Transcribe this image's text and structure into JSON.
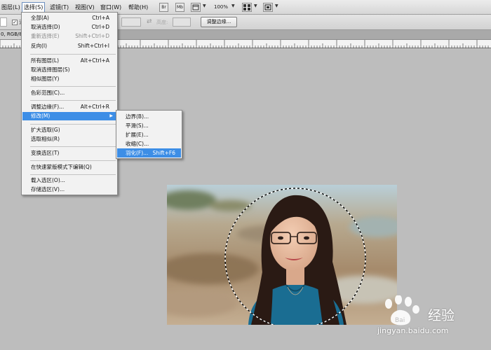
{
  "menubar": {
    "items": [
      "图层(L)",
      "选择(S)",
      "滤镜(T)",
      "视图(V)",
      "窗口(W)",
      "帮助(H)"
    ],
    "toolbar_buttons": [
      "Br",
      "Mb"
    ],
    "zoom": "100%"
  },
  "options": {
    "anti_alias": "消",
    "height_label": "高度:",
    "refine_edge_button": "调整边缘..."
  },
  "document": {
    "tab_label": "0, RGB/8"
  },
  "select_menu": {
    "items": [
      {
        "label": "全部(A)",
        "shortcut": "Ctrl+A"
      },
      {
        "label": "取消选择(D)",
        "shortcut": "Ctrl+D"
      },
      {
        "label": "重新选择(E)",
        "shortcut": "Shift+Ctrl+D"
      },
      {
        "label": "反向(I)",
        "shortcut": "Shift+Ctrl+I"
      },
      {
        "label": "所有图层(L)",
        "shortcut": "Alt+Ctrl+A"
      },
      {
        "label": "取消选择图层(S)",
        "shortcut": ""
      },
      {
        "label": "相似图层(Y)",
        "shortcut": ""
      },
      {
        "label": "色彩范围(C)...",
        "shortcut": ""
      },
      {
        "label": "调整边缘(F)...",
        "shortcut": "Alt+Ctrl+R"
      },
      {
        "label": "修改(M)",
        "shortcut": ""
      },
      {
        "label": "扩大选取(G)",
        "shortcut": ""
      },
      {
        "label": "选取相似(R)",
        "shortcut": ""
      },
      {
        "label": "变换选区(T)",
        "shortcut": ""
      },
      {
        "label": "在快速蒙版模式下编辑(Q)",
        "shortcut": ""
      },
      {
        "label": "载入选区(O)...",
        "shortcut": ""
      },
      {
        "label": "存储选区(V)...",
        "shortcut": ""
      }
    ]
  },
  "modify_submenu": {
    "items": [
      {
        "label": "边界(B)...",
        "shortcut": ""
      },
      {
        "label": "平滑(S)...",
        "shortcut": ""
      },
      {
        "label": "扩展(E)...",
        "shortcut": ""
      },
      {
        "label": "收缩(C)...",
        "shortcut": ""
      },
      {
        "label": "羽化(F)...",
        "shortcut": "Shift+F6"
      }
    ]
  },
  "watermark": {
    "brand": "经验",
    "url": "jingyan.baidu.com"
  },
  "colors": {
    "highlight": "#3d8ee6",
    "workspace": "#bdbdbd",
    "menu_bg": "#f2f2f2",
    "shirt": "#1a6d92"
  },
  "icons": [
    "arrange-docs-icon",
    "screen-mode-icon",
    "extras-icon",
    "select-menu-arrow-icon",
    "paw-logo-icon"
  ]
}
